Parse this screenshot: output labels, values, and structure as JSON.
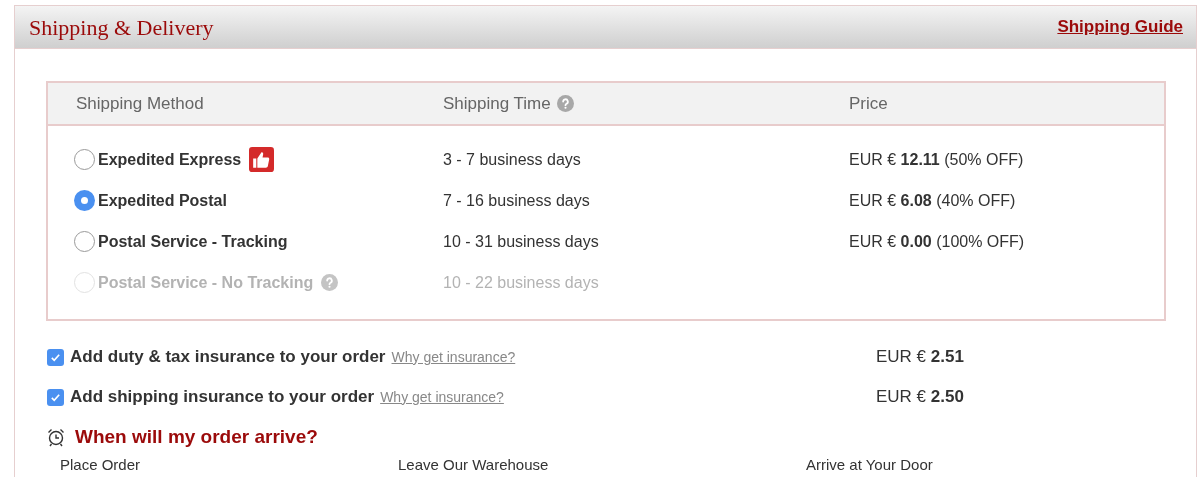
{
  "panel": {
    "title": "Shipping & Delivery",
    "guide_link": "Shipping Guide"
  },
  "table": {
    "columns": [
      {
        "label": "Shipping Method",
        "help": false
      },
      {
        "label": "Shipping Time",
        "help": true
      },
      {
        "label": "Price",
        "help": false
      }
    ],
    "rows": [
      {
        "method": "Expedited Express",
        "selected": false,
        "disabled": false,
        "recommended": true,
        "help": false,
        "time": "3 - 7 business days",
        "price": "EUR € **12.11** (50% OFF)"
      },
      {
        "method": "Expedited Postal",
        "selected": true,
        "disabled": false,
        "recommended": false,
        "help": false,
        "time": "7 - 16 business days",
        "price": "EUR € **6.08** (40% OFF)"
      },
      {
        "method": "Postal Service - Tracking",
        "selected": false,
        "disabled": false,
        "recommended": false,
        "help": false,
        "time": "10 - 31 business days",
        "price": "EUR € **0.00** (100% OFF)"
      },
      {
        "method": "Postal Service - No Tracking",
        "selected": false,
        "disabled": true,
        "recommended": false,
        "help": true,
        "time": "10 - 22 business days"
      }
    ]
  },
  "insurance": [
    {
      "label": "Add duty & tax insurance to your order",
      "checked": true,
      "link": "Why get insurance?",
      "price": "EUR € **2.51**"
    },
    {
      "label": "Add shipping insurance to your order",
      "checked": true,
      "link": "Why get insurance?",
      "price": "EUR € **2.50**"
    }
  ],
  "arrival": {
    "title": "When will my order arrive?",
    "steps": [
      "Place Order",
      "Leave Our Warehouse",
      "Arrive at Your Door"
    ]
  }
}
